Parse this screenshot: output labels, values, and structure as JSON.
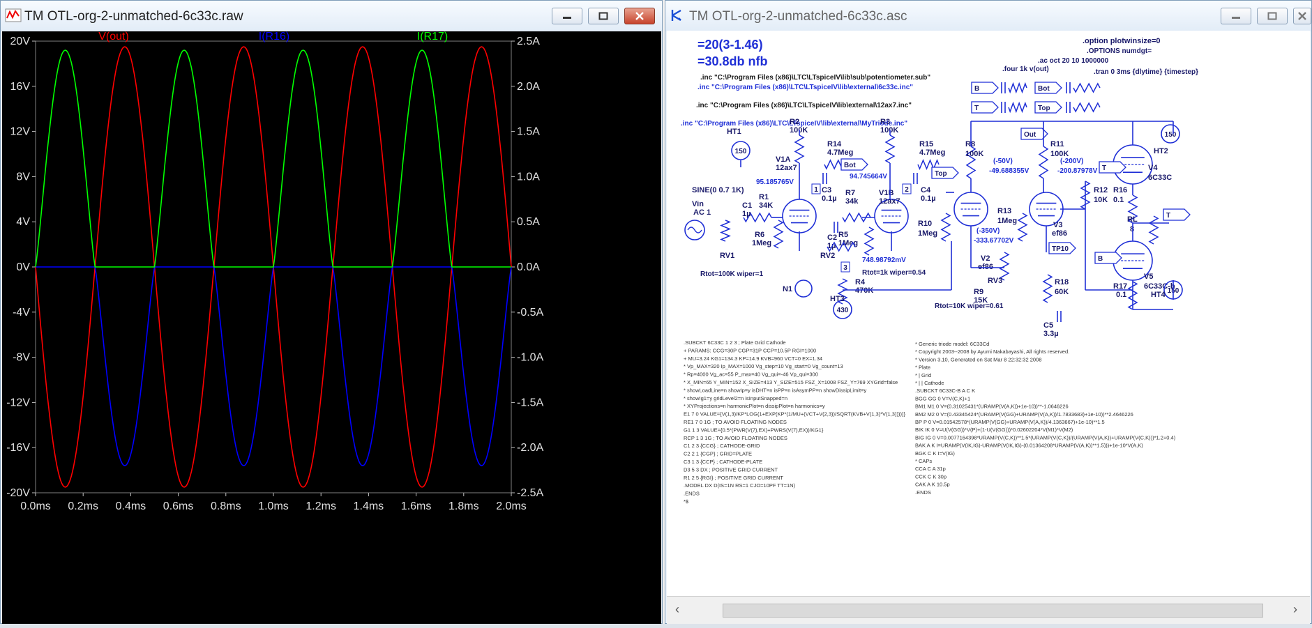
{
  "waveform": {
    "title": "TM OTL-org-2-unmatched-6c33c.raw",
    "traces": [
      {
        "label": "V(out)",
        "color": "#ff0000"
      },
      {
        "label": "I(R16)",
        "color": "#0000ff"
      },
      {
        "label": "I(R17)",
        "color": "#00ff00"
      }
    ],
    "left_ticks": [
      "20V",
      "16V",
      "12V",
      "8V",
      "4V",
      "0V",
      "-4V",
      "-8V",
      "-12V",
      "-16V",
      "-20V"
    ],
    "right_ticks": [
      "2.5A",
      "2.0A",
      "1.5A",
      "1.0A",
      "0.5A",
      "0.0A",
      "-0.5A",
      "-1.0A",
      "-1.5A",
      "-2.0A",
      "-2.5A"
    ],
    "x_ticks": [
      "0.0ms",
      "0.2ms",
      "0.4ms",
      "0.6ms",
      "0.8ms",
      "1.0ms",
      "1.2ms",
      "1.4ms",
      "1.6ms",
      "1.8ms",
      "2.0ms"
    ]
  },
  "chart_data": {
    "type": "line",
    "xlabel": "",
    "xlim": [
      0,
      2.0
    ],
    "ylim_left": [
      -20,
      20
    ],
    "ylim_right": [
      -2.5,
      2.5
    ],
    "grid": false,
    "legend": "top",
    "series": [
      {
        "name": "V(out)",
        "axis": "left",
        "color": "#ff0000",
        "shape": "sine",
        "freq_khz": 2,
        "amplitude": 19.5,
        "phase_sign": -1
      },
      {
        "name": "I(R16)",
        "axis": "right",
        "color": "#0000ff",
        "shape": "half-wave",
        "freq_khz": 2,
        "peak": -2.2
      },
      {
        "name": "I(R17)",
        "axis": "right",
        "color": "#00ff00",
        "shape": "half-wave",
        "freq_khz": 2,
        "peak": 2.4
      }
    ]
  },
  "schematic": {
    "title": "TM OTL-org-2-unmatched-6c33c.asc",
    "top_lines": [
      "=20(3-1.46)",
      "=30.8db nfb"
    ],
    "includes": [
      ".inc \"C:\\Program Files (x86)\\LTC\\LTspiceIV\\lib\\sub\\potentiometer.sub\"",
      ".inc \"C:\\Program Files (x86)\\LTC\\LTspiceIV\\lib\\external\\6c33c.inc\"",
      ".inc \"C:\\Program Files (x86)\\LTC\\LTspiceIV\\lib\\external\\12ax7.inc\"",
      ".inc \"C:\\Program Files (x86)\\LTC\\LTspiceIV\\lib\\external\\MyTriode.inc\""
    ],
    "directives": [
      ".four 1k v(out)",
      ".tran 0 3ms {dlytime} {timestep}",
      ".option plotwinsize=0",
      ".OPTIONS numdgt=",
      ".ac oct 20 10 1000000"
    ],
    "labels": [
      "HT1",
      "150",
      "R2",
      "100K",
      "R3",
      "100K",
      "R14",
      "4.7Meg",
      "R15",
      "4.7Meg",
      "V1A",
      "12ax7",
      "V1B",
      "12ax7",
      "95.185765V",
      "94.745664V",
      "Bot",
      "Top",
      "C3",
      "0.1µ",
      "C4",
      "0.1µ",
      "SINE(0 0.7 1K)",
      "Vin",
      "AC 1",
      "C1",
      "1µ",
      "R1",
      "34K",
      "R7",
      "34k",
      "R6",
      "1Meg",
      "C2",
      "1µ",
      "R5",
      "1Meg",
      "RV1",
      "RV2",
      "748.98792mV",
      "Rtot=100K wiper=1",
      "Rtot=1k wiper=0.54",
      "N1",
      "R4",
      "470K",
      "HT3",
      "430",
      "R8",
      "100K",
      "R11",
      "100K",
      "(-50V)",
      "-49.688355V",
      "(-200V)",
      "-200.87978V",
      "Out",
      "R10",
      "1Meg",
      "R13",
      "1Meg",
      "(-350V)",
      "-333.67702V",
      "V2",
      "ef86",
      "V3",
      "ef86",
      "RV3",
      "R9",
      "15K",
      "Rtot=10K wiper=0.61",
      "R18",
      "60K",
      "C5",
      "3.3µ",
      "R12",
      "10K",
      "TP10",
      "HT2",
      "V4",
      "6C33C",
      "R16",
      "0.1",
      "RL",
      "8",
      "V5",
      "6C33C-b",
      "R17",
      "0.1",
      "HT4",
      "1",
      "2",
      "3",
      "T",
      "B",
      "Out",
      "Bot",
      "Top"
    ],
    "netlist_left": [
      ".SUBCKT 6C33C 1 2 3 ; Plate Grid Cathode",
      "+ PARAMS: CCG=30P CGP=31P CCP=10.5P RGI=1000",
      "+ MU=3.24 KG1=134.3 KP=14.9 KVB=960 VCT=0 EX=1.34",
      "* Vp_MAX=320 Ip_MAX=1000 Vg_step=10 Vg_start=0 Vg_count=13",
      "* Rp=4000 Vg_ac=55 P_max=40 Vg_qui=-46 Vp_qui=300",
      "* X_MIN=65 Y_MIN=152 X_SIZE=413 Y_SIZE=515 FSZ_X=1008 FSZ_Y=769 XYGrid=false",
      "* showLoadLine=n showIp=y isDHT=n isPP=n isAsymPP=n showDissipLimit=y",
      "* showIg1=y gridLevel2=n isInputSnapped=n",
      "* XYProjections=n harmonicPlot=n dissipPlot=n harmonics=y",
      "E1 7 0 VALUE={V(1,3)/KP*LOG(1+EXP(KP*(1/MU+(VCT+V(2,3))/SQRT(KVB+V(1,3)*V(1,3)))))}",
      "RE1 7 0 1G ; TO AVOID FLOATING NODES",
      "G1 1 3 VALUE={0.5*(PWR(V(7),EX)+PWRS(V(7),EX))/KG1}",
      "RCP 1 3 1G ; TO AVOID FLOATING NODES",
      "C1 2 3 {CCG} ; CATHODE-GRID",
      "C2 2 1 {CGP} ; GRID=PLATE",
      "C3 1 3 {CCP} ; CATHODE-PLATE",
      "D3 5 3 DX ; POSITIVE GRID CURRENT",
      "R1 2 5 {RGI} ; POSITIVE GRID CURRENT",
      ".MODEL DX D(IS=1N RS=1 CJO=10PF TT=1N)",
      ".ENDS",
      "*$"
    ],
    "netlist_right": [
      "* Generic triode model: 6C33Cd",
      "* Copyright 2003--2008 by Ayumi Nakabayashi, All rights reserved.",
      "* Version 3.10, Generated on Sat Mar  8 22:32:32 2008",
      "*           Plate",
      "*           | Grid",
      "*           | | Cathode",
      ".SUBCKT 6C33C-B A C K",
      "BGG  GG  0 V=V(C,K)+1",
      "BM1  M1  0 V=(0.31025431*(URAMP(V(A,K))+1e-10))**-1.0646226",
      "BM2  M2  0 V=(0.43345424*(URAMP(V(GG)+URAMP(V(A,K))/1.7833683)+1e-10))**2.4646226",
      "BP   P   0 V=0.01542578*(URAMP(V(GG)+URAMP(V(A,K))/4.1363667)+1e-10)**1.5",
      "BIK  IK  0 V=U(V(GG))*V(P)+(1-U(V(GG)))*0.02602204*V(M1)*V(M2)",
      "BIG  IG  0 V=0.0077164398*URAMP(V(C,K))**1.5*(URAMP(V(C,K))/(URAMP(V(A,K))+URAMP(V(C,K)))*1.2+0.4)",
      "BAK  A   K I=URAMP(V(IK,IG)-URAMP(V(IK,IG)-(0.01364208*URAMP(V(A,K))**1.5)))+1e-10*V(A,K)",
      "BGK  C   K I=V(IG)",
      "* CAPs",
      "CCA  C   A 31p",
      "CCK  C   K 30p",
      "CAK  A   K 10.5p",
      ".ENDS"
    ]
  }
}
